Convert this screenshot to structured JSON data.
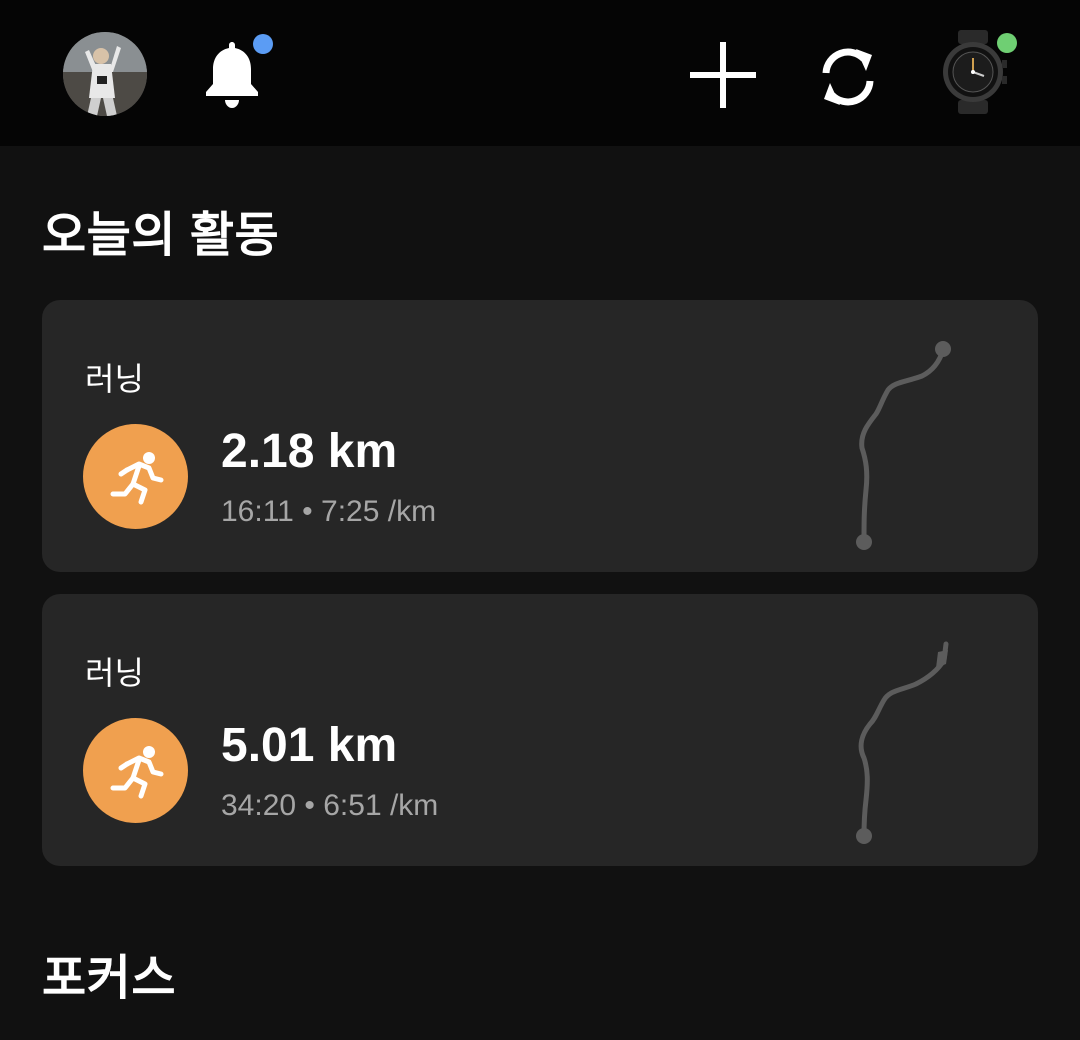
{
  "header": {
    "notification_dot_color": "#5b9cf4",
    "device_status_color": "#6fcf73",
    "icons": [
      "avatar",
      "bell-icon",
      "plus-icon",
      "sync-icon",
      "watch-icon"
    ]
  },
  "today": {
    "title": "오늘의 활동",
    "accent_color": "#f0a04f",
    "activities": [
      {
        "label": "러닝",
        "distance": "2.18 km",
        "stats": "16:11 • 7:25 /km"
      },
      {
        "label": "러닝",
        "distance": "5.01 km",
        "stats": "34:20 • 6:51 /km"
      }
    ]
  },
  "focus": {
    "title": "포커스"
  }
}
